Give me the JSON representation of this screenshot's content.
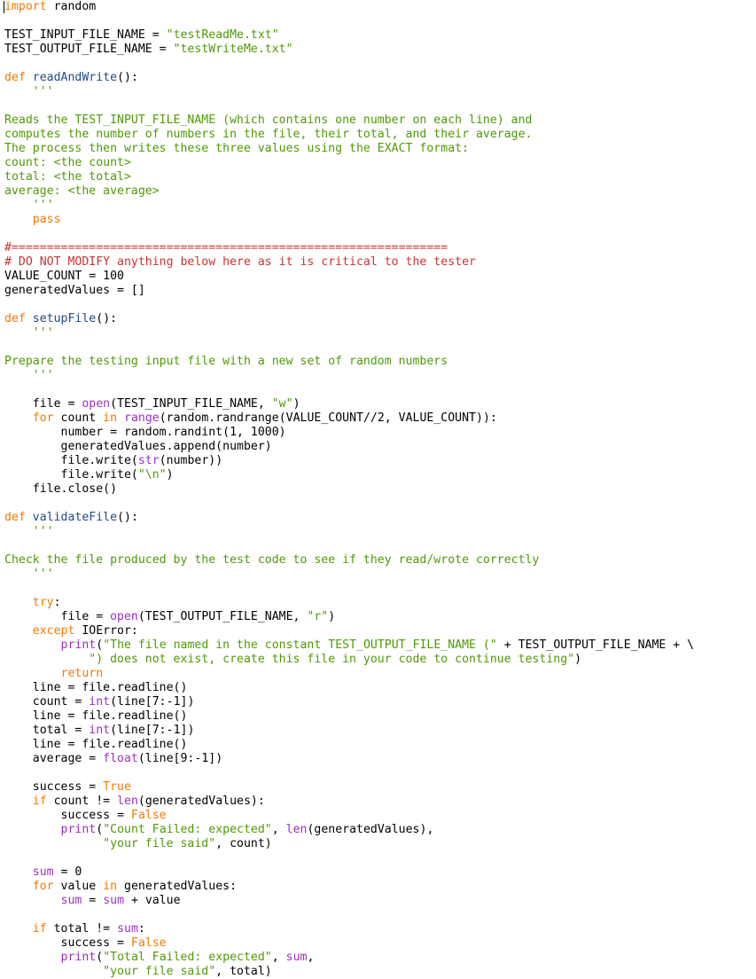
{
  "editor": {
    "language": "Python",
    "background_color": "#ffffff",
    "font_size_px": 13.2,
    "line_height_px": 16,
    "caret": {
      "name": "text-caret",
      "line": 1,
      "column": 1
    },
    "colors": {
      "text": "#000000",
      "keyword": "#f57900",
      "function_name": "#204a87",
      "builtin": "#9b30c0",
      "string": "#4e9a06",
      "comment": "#cc3333"
    }
  },
  "code": {
    "lines": [
      {
        "n": 1,
        "tokens": [
          {
            "t": "import",
            "c": "kw"
          },
          {
            "t": " random",
            "c": "pln"
          }
        ]
      },
      {
        "n": 2,
        "tokens": []
      },
      {
        "n": 3,
        "tokens": [
          {
            "t": "TEST_INPUT_FILE_NAME = ",
            "c": "pln"
          },
          {
            "t": "\"testReadMe.txt\"",
            "c": "str"
          }
        ]
      },
      {
        "n": 4,
        "tokens": [
          {
            "t": "TEST_OUTPUT_FILE_NAME = ",
            "c": "pln"
          },
          {
            "t": "\"testWriteMe.txt\"",
            "c": "str"
          }
        ]
      },
      {
        "n": 5,
        "tokens": []
      },
      {
        "n": 6,
        "tokens": [
          {
            "t": "def",
            "c": "kw"
          },
          {
            "t": " ",
            "c": "pln"
          },
          {
            "t": "readAndWrite",
            "c": "fn"
          },
          {
            "t": "():",
            "c": "pln"
          }
        ]
      },
      {
        "n": 7,
        "tokens": [
          {
            "t": "    '''",
            "c": "str"
          }
        ]
      },
      {
        "n": 8,
        "tokens": [
          {
            "t": "",
            "c": "str"
          }
        ]
      },
      {
        "n": 9,
        "tokens": [
          {
            "t": "Reads the TEST_INPUT_FILE_NAME (which contains one number on each line) and",
            "c": "str"
          }
        ]
      },
      {
        "n": 10,
        "tokens": [
          {
            "t": "computes the number of numbers in the file, their total, and their average.",
            "c": "str"
          }
        ]
      },
      {
        "n": 11,
        "tokens": [
          {
            "t": "The process then writes these three values using the EXACT format:",
            "c": "str"
          }
        ]
      },
      {
        "n": 12,
        "tokens": [
          {
            "t": "count: <the count>",
            "c": "str"
          }
        ]
      },
      {
        "n": 13,
        "tokens": [
          {
            "t": "total: <the total>",
            "c": "str"
          }
        ]
      },
      {
        "n": 14,
        "tokens": [
          {
            "t": "average: <the average>",
            "c": "str"
          }
        ]
      },
      {
        "n": 15,
        "tokens": [
          {
            "t": "    '''",
            "c": "str"
          }
        ]
      },
      {
        "n": 16,
        "tokens": [
          {
            "t": "    ",
            "c": "pln"
          },
          {
            "t": "pass",
            "c": "kw"
          }
        ]
      },
      {
        "n": 17,
        "tokens": []
      },
      {
        "n": 18,
        "tokens": [
          {
            "t": "#==============================================================",
            "c": "cmt"
          }
        ]
      },
      {
        "n": 19,
        "tokens": [
          {
            "t": "# DO NOT MODIFY anything below here as it is critical to the tester",
            "c": "cmt"
          }
        ]
      },
      {
        "n": 20,
        "tokens": [
          {
            "t": "VALUE_COUNT = 100",
            "c": "pln"
          }
        ]
      },
      {
        "n": 21,
        "tokens": [
          {
            "t": "generatedValues = []",
            "c": "pln"
          }
        ]
      },
      {
        "n": 22,
        "tokens": []
      },
      {
        "n": 23,
        "tokens": [
          {
            "t": "def",
            "c": "kw"
          },
          {
            "t": " ",
            "c": "pln"
          },
          {
            "t": "setupFile",
            "c": "fn"
          },
          {
            "t": "():",
            "c": "pln"
          }
        ]
      },
      {
        "n": 24,
        "tokens": [
          {
            "t": "    '''",
            "c": "str"
          }
        ]
      },
      {
        "n": 25,
        "tokens": [
          {
            "t": "",
            "c": "str"
          }
        ]
      },
      {
        "n": 26,
        "tokens": [
          {
            "t": "Prepare the testing input file with a new set of random numbers",
            "c": "str"
          }
        ]
      },
      {
        "n": 27,
        "tokens": [
          {
            "t": "    '''",
            "c": "str"
          }
        ]
      },
      {
        "n": 28,
        "tokens": []
      },
      {
        "n": 29,
        "tokens": [
          {
            "t": "    file = ",
            "c": "pln"
          },
          {
            "t": "open",
            "c": "bi"
          },
          {
            "t": "(TEST_INPUT_FILE_NAME, ",
            "c": "pln"
          },
          {
            "t": "\"w\"",
            "c": "str"
          },
          {
            "t": ")",
            "c": "pln"
          }
        ]
      },
      {
        "n": 30,
        "tokens": [
          {
            "t": "    ",
            "c": "pln"
          },
          {
            "t": "for",
            "c": "kw"
          },
          {
            "t": " count ",
            "c": "pln"
          },
          {
            "t": "in",
            "c": "kw"
          },
          {
            "t": " ",
            "c": "pln"
          },
          {
            "t": "range",
            "c": "bi"
          },
          {
            "t": "(random.randrange(VALUE_COUNT//2, VALUE_COUNT)):",
            "c": "pln"
          }
        ]
      },
      {
        "n": 31,
        "tokens": [
          {
            "t": "        number = random.randint(1, 1000)",
            "c": "pln"
          }
        ]
      },
      {
        "n": 32,
        "tokens": [
          {
            "t": "        generatedValues.append(number)",
            "c": "pln"
          }
        ]
      },
      {
        "n": 33,
        "tokens": [
          {
            "t": "        file.write(",
            "c": "pln"
          },
          {
            "t": "str",
            "c": "bi"
          },
          {
            "t": "(number))",
            "c": "pln"
          }
        ]
      },
      {
        "n": 34,
        "tokens": [
          {
            "t": "        file.write(",
            "c": "pln"
          },
          {
            "t": "\"\\n\"",
            "c": "str"
          },
          {
            "t": ")",
            "c": "pln"
          }
        ]
      },
      {
        "n": 35,
        "tokens": [
          {
            "t": "    file.close()",
            "c": "pln"
          }
        ]
      },
      {
        "n": 36,
        "tokens": []
      },
      {
        "n": 37,
        "tokens": [
          {
            "t": "def",
            "c": "kw"
          },
          {
            "t": " ",
            "c": "pln"
          },
          {
            "t": "validateFile",
            "c": "fn"
          },
          {
            "t": "():",
            "c": "pln"
          }
        ]
      },
      {
        "n": 38,
        "tokens": [
          {
            "t": "    '''",
            "c": "str"
          }
        ]
      },
      {
        "n": 39,
        "tokens": [
          {
            "t": "",
            "c": "str"
          }
        ]
      },
      {
        "n": 40,
        "tokens": [
          {
            "t": "Check the file produced by the test code to see if they read/wrote correctly",
            "c": "str"
          }
        ]
      },
      {
        "n": 41,
        "tokens": [
          {
            "t": "    '''",
            "c": "str"
          }
        ]
      },
      {
        "n": 42,
        "tokens": []
      },
      {
        "n": 43,
        "tokens": [
          {
            "t": "    ",
            "c": "pln"
          },
          {
            "t": "try",
            "c": "kw"
          },
          {
            "t": ":",
            "c": "pln"
          }
        ]
      },
      {
        "n": 44,
        "tokens": [
          {
            "t": "        file = ",
            "c": "pln"
          },
          {
            "t": "open",
            "c": "bi"
          },
          {
            "t": "(TEST_OUTPUT_FILE_NAME, ",
            "c": "pln"
          },
          {
            "t": "\"r\"",
            "c": "str"
          },
          {
            "t": ")",
            "c": "pln"
          }
        ]
      },
      {
        "n": 45,
        "tokens": [
          {
            "t": "    ",
            "c": "pln"
          },
          {
            "t": "except",
            "c": "kw"
          },
          {
            "t": " IOError:",
            "c": "pln"
          }
        ]
      },
      {
        "n": 46,
        "tokens": [
          {
            "t": "        ",
            "c": "pln"
          },
          {
            "t": "print",
            "c": "bi"
          },
          {
            "t": "(",
            "c": "pln"
          },
          {
            "t": "\"The file named in the constant TEST_OUTPUT_FILE_NAME (\"",
            "c": "str"
          },
          {
            "t": " + TEST_OUTPUT_FILE_NAME + \\",
            "c": "pln"
          }
        ]
      },
      {
        "n": 47,
        "tokens": [
          {
            "t": "            ",
            "c": "pln"
          },
          {
            "t": "\") does not exist, create this file in your code to continue testing\"",
            "c": "str"
          },
          {
            "t": ")",
            "c": "pln"
          }
        ]
      },
      {
        "n": 48,
        "tokens": [
          {
            "t": "        ",
            "c": "pln"
          },
          {
            "t": "return",
            "c": "kw"
          }
        ]
      },
      {
        "n": 49,
        "tokens": [
          {
            "t": "    line = file.readline()",
            "c": "pln"
          }
        ]
      },
      {
        "n": 50,
        "tokens": [
          {
            "t": "    count = ",
            "c": "pln"
          },
          {
            "t": "int",
            "c": "bi"
          },
          {
            "t": "(line[7:-1])",
            "c": "pln"
          }
        ]
      },
      {
        "n": 51,
        "tokens": [
          {
            "t": "    line = file.readline()",
            "c": "pln"
          }
        ]
      },
      {
        "n": 52,
        "tokens": [
          {
            "t": "    total = ",
            "c": "pln"
          },
          {
            "t": "int",
            "c": "bi"
          },
          {
            "t": "(line[7:-1])",
            "c": "pln"
          }
        ]
      },
      {
        "n": 53,
        "tokens": [
          {
            "t": "    line = file.readline()",
            "c": "pln"
          }
        ]
      },
      {
        "n": 54,
        "tokens": [
          {
            "t": "    average = ",
            "c": "pln"
          },
          {
            "t": "float",
            "c": "bi"
          },
          {
            "t": "(line[9:-1])",
            "c": "pln"
          }
        ]
      },
      {
        "n": 55,
        "tokens": []
      },
      {
        "n": 56,
        "tokens": [
          {
            "t": "    success = ",
            "c": "pln"
          },
          {
            "t": "True",
            "c": "kw"
          }
        ]
      },
      {
        "n": 57,
        "tokens": [
          {
            "t": "    ",
            "c": "pln"
          },
          {
            "t": "if",
            "c": "kw"
          },
          {
            "t": " count != ",
            "c": "pln"
          },
          {
            "t": "len",
            "c": "bi"
          },
          {
            "t": "(generatedValues):",
            "c": "pln"
          }
        ]
      },
      {
        "n": 58,
        "tokens": [
          {
            "t": "        success = ",
            "c": "pln"
          },
          {
            "t": "False",
            "c": "kw"
          }
        ]
      },
      {
        "n": 59,
        "tokens": [
          {
            "t": "        ",
            "c": "pln"
          },
          {
            "t": "print",
            "c": "bi"
          },
          {
            "t": "(",
            "c": "pln"
          },
          {
            "t": "\"Count Failed: expected\"",
            "c": "str"
          },
          {
            "t": ", ",
            "c": "pln"
          },
          {
            "t": "len",
            "c": "bi"
          },
          {
            "t": "(generatedValues),",
            "c": "pln"
          }
        ]
      },
      {
        "n": 60,
        "tokens": [
          {
            "t": "              ",
            "c": "pln"
          },
          {
            "t": "\"your file said\"",
            "c": "str"
          },
          {
            "t": ", count)",
            "c": "pln"
          }
        ]
      },
      {
        "n": 61,
        "tokens": []
      },
      {
        "n": 62,
        "tokens": [
          {
            "t": "    ",
            "c": "pln"
          },
          {
            "t": "sum",
            "c": "bi"
          },
          {
            "t": " = 0",
            "c": "pln"
          }
        ]
      },
      {
        "n": 63,
        "tokens": [
          {
            "t": "    ",
            "c": "pln"
          },
          {
            "t": "for",
            "c": "kw"
          },
          {
            "t": " value ",
            "c": "pln"
          },
          {
            "t": "in",
            "c": "kw"
          },
          {
            "t": " generatedValues:",
            "c": "pln"
          }
        ]
      },
      {
        "n": 64,
        "tokens": [
          {
            "t": "        ",
            "c": "pln"
          },
          {
            "t": "sum",
            "c": "bi"
          },
          {
            "t": " = ",
            "c": "pln"
          },
          {
            "t": "sum",
            "c": "bi"
          },
          {
            "t": " + value",
            "c": "pln"
          }
        ]
      },
      {
        "n": 65,
        "tokens": []
      },
      {
        "n": 66,
        "tokens": [
          {
            "t": "    ",
            "c": "pln"
          },
          {
            "t": "if",
            "c": "kw"
          },
          {
            "t": " total != ",
            "c": "pln"
          },
          {
            "t": "sum",
            "c": "bi"
          },
          {
            "t": ":",
            "c": "pln"
          }
        ]
      },
      {
        "n": 67,
        "tokens": [
          {
            "t": "        success = ",
            "c": "pln"
          },
          {
            "t": "False",
            "c": "kw"
          }
        ]
      },
      {
        "n": 68,
        "tokens": [
          {
            "t": "        ",
            "c": "pln"
          },
          {
            "t": "print",
            "c": "bi"
          },
          {
            "t": "(",
            "c": "pln"
          },
          {
            "t": "\"Total Failed: expected\"",
            "c": "str"
          },
          {
            "t": ", ",
            "c": "pln"
          },
          {
            "t": "sum",
            "c": "bi"
          },
          {
            "t": ",",
            "c": "pln"
          }
        ]
      },
      {
        "n": 69,
        "tokens": [
          {
            "t": "              ",
            "c": "pln"
          },
          {
            "t": "\"your file said\"",
            "c": "str"
          },
          {
            "t": ", total)",
            "c": "pln"
          }
        ]
      }
    ]
  }
}
